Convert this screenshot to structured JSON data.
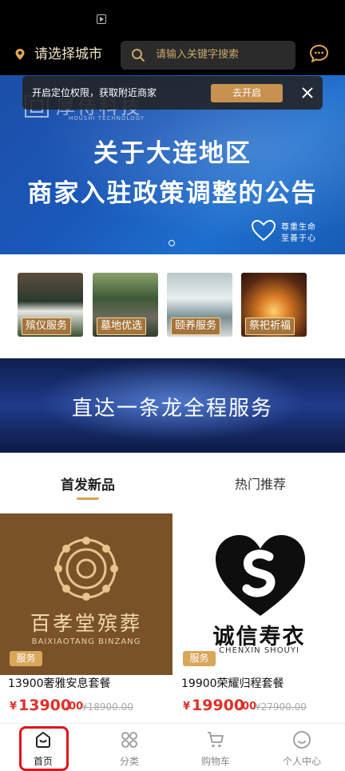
{
  "header": {
    "city_label": "请选择城市",
    "search_placeholder": "请输入关键字搜索"
  },
  "toast": {
    "text": "开启定位权限，获取附近商家",
    "button": "去开启"
  },
  "banner": {
    "brand_cn": "厚侍科技",
    "brand_en": "HOUSHI TECHNOLOGY",
    "line1": "关于大连地区",
    "line2": "商家入驻政策调整的公告",
    "slogan1": "尊重生命",
    "slogan2": "至善于心"
  },
  "categories": [
    {
      "label": "殡仪服务"
    },
    {
      "label": "墓地优选"
    },
    {
      "label": "颐养服务"
    },
    {
      "label": "祭祀祈福"
    }
  ],
  "service_banner": {
    "text": "直达一条龙全程服务"
  },
  "tabs": {
    "new": "首发新品",
    "hot": "热门推荐"
  },
  "products": [
    {
      "brand_cn": "百孝堂殡葬",
      "brand_en": "BAIXIAOTANG BINZANG",
      "tag": "服务",
      "name": "13900奢雅安息套餐",
      "currency": "¥",
      "price_int": "13900",
      "price_dec": ".00",
      "old_price": "¥18900.00"
    },
    {
      "brand_cn": "诚信寿衣",
      "brand_en": "CHENXIN SHOUYI",
      "tag": "服务",
      "name": "19900荣耀归程套餐",
      "currency": "¥",
      "price_int": "19900",
      "price_dec": ".00",
      "old_price": "¥27900.00"
    }
  ],
  "bottom_nav": [
    {
      "label": "首页",
      "icon": "home-icon"
    },
    {
      "label": "分类",
      "icon": "category-icon"
    },
    {
      "label": "购物车",
      "icon": "cart-icon"
    },
    {
      "label": "个人中心",
      "icon": "profile-icon"
    }
  ],
  "colors": {
    "accent_gold": "#c8914f",
    "price_red": "#e0302a",
    "banner_blue": "#1a58b8",
    "highlight_red": "#e0141c"
  }
}
